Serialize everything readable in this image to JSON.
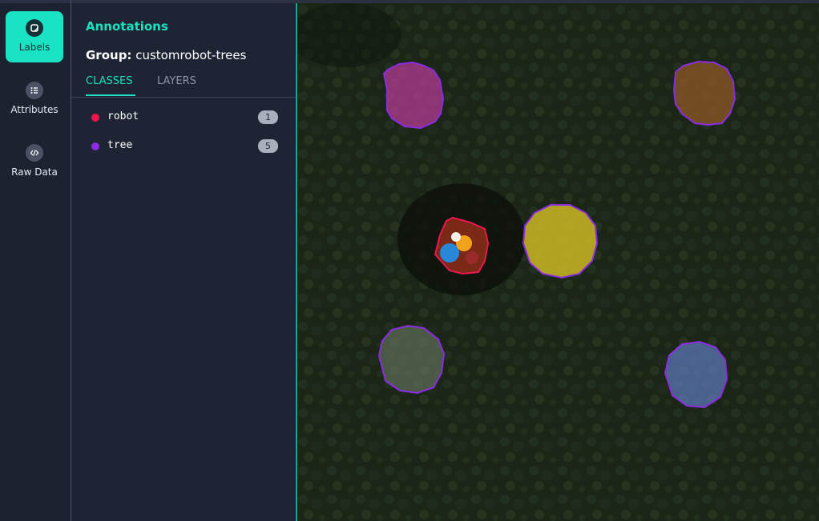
{
  "sidebar": {
    "items": [
      {
        "label": "Labels",
        "icon": "labels-icon",
        "active": true
      },
      {
        "label": "Attributes",
        "icon": "attributes-icon",
        "active": false
      },
      {
        "label": "Raw Data",
        "icon": "code-icon",
        "active": false
      }
    ]
  },
  "panel": {
    "title": "Annotations",
    "group_label": "Group:",
    "group_value": "customrobot-trees",
    "tabs": [
      {
        "label": "CLASSES",
        "active": true
      },
      {
        "label": "LAYERS",
        "active": false
      }
    ],
    "classes": [
      {
        "name": "robot",
        "count": "1",
        "color": "#e8174f"
      },
      {
        "name": "tree",
        "count": "5",
        "color": "#8b2be2"
      }
    ]
  },
  "colors": {
    "accent": "#19e3c4",
    "robot": "#e8174f",
    "tree": "#8b2be2"
  }
}
